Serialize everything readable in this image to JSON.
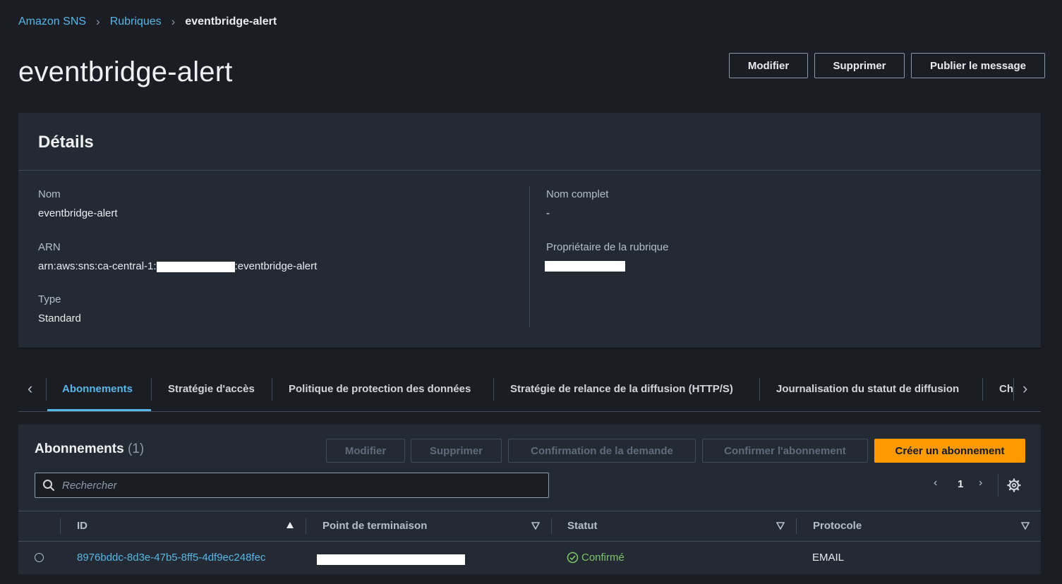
{
  "breadcrumb": {
    "items": [
      "Amazon SNS",
      "Rubriques"
    ],
    "current": "eventbridge-alert"
  },
  "header": {
    "title": "eventbridge-alert",
    "buttons": {
      "edit": "Modifier",
      "delete": "Supprimer",
      "publish": "Publier le message"
    }
  },
  "details": {
    "title": "Détails",
    "name_label": "Nom",
    "name_value": "eventbridge-alert",
    "arn_label": "ARN",
    "arn_prefix": "arn:aws:sns:ca-central-1:",
    "arn_suffix": ":eventbridge-alert",
    "type_label": "Type",
    "type_value": "Standard",
    "fullname_label": "Nom complet",
    "fullname_value": "-",
    "owner_label": "Propriétaire de la rubrique"
  },
  "tabs": [
    {
      "label": "Abonnements",
      "active": true
    },
    {
      "label": "Stratégie d'accès",
      "active": false
    },
    {
      "label": "Politique de protection des données",
      "active": false
    },
    {
      "label": "Stratégie de relance de la diffusion (HTTP/S)",
      "active": false
    },
    {
      "label": "Journalisation du statut de diffusion",
      "active": false
    },
    {
      "label": "Ch",
      "active": false
    }
  ],
  "subscriptions": {
    "title": "Abonnements",
    "count": "(1)",
    "buttons": {
      "edit": "Modifier",
      "delete": "Supprimer",
      "request_confirmation": "Confirmation de la demande",
      "confirm": "Confirmer l'abonnement",
      "create": "Créer un abonnement"
    },
    "search_placeholder": "Rechercher",
    "page": "1",
    "columns": [
      "ID",
      "Point de terminaison",
      "Statut",
      "Protocole"
    ],
    "rows": [
      {
        "id": "8976bddc-8d3e-47b5-8ff5-4df9ec248fec",
        "status": "Confirmé",
        "protocol": "EMAIL"
      }
    ]
  },
  "colors": {
    "accent": "#59b6e6",
    "primary_button": "#ff9900",
    "success": "#7ec26b",
    "background": "#1a1d24",
    "panel": "#232a33"
  }
}
